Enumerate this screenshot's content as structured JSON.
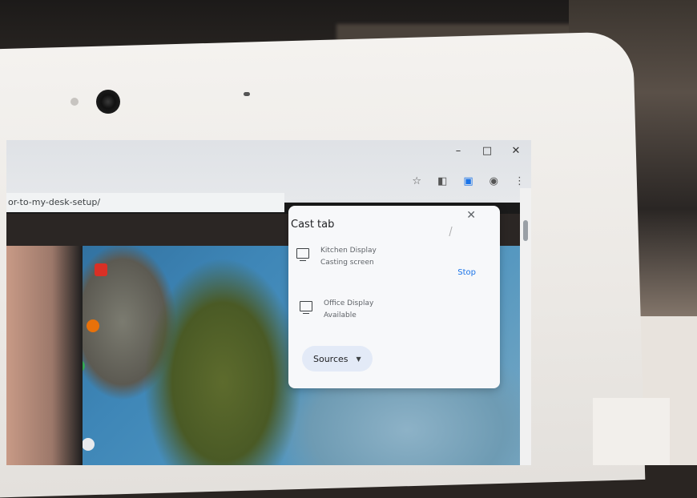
{
  "browser": {
    "url_text": "or-to-my-desk-setup/",
    "window_controls": [
      "–",
      "□",
      "✕"
    ]
  },
  "toolbar": {
    "icons": [
      "star-icon",
      "reading-list-icon",
      "cast-icon",
      "account-icon",
      "menu-icon"
    ]
  },
  "cast_popup": {
    "title": "Cast tab",
    "close_label": "✕",
    "devices": [
      {
        "name": "Kitchen Display",
        "status": "Casting screen",
        "action": "Stop"
      },
      {
        "name": "Office Display",
        "status": "Available"
      }
    ],
    "sources_label": "Sources",
    "sources_caret": "▼"
  },
  "colors": {
    "accent": "#1a73e8",
    "popup_bg": "#f7f8fa",
    "sources_bg": "#e3eaf7"
  }
}
